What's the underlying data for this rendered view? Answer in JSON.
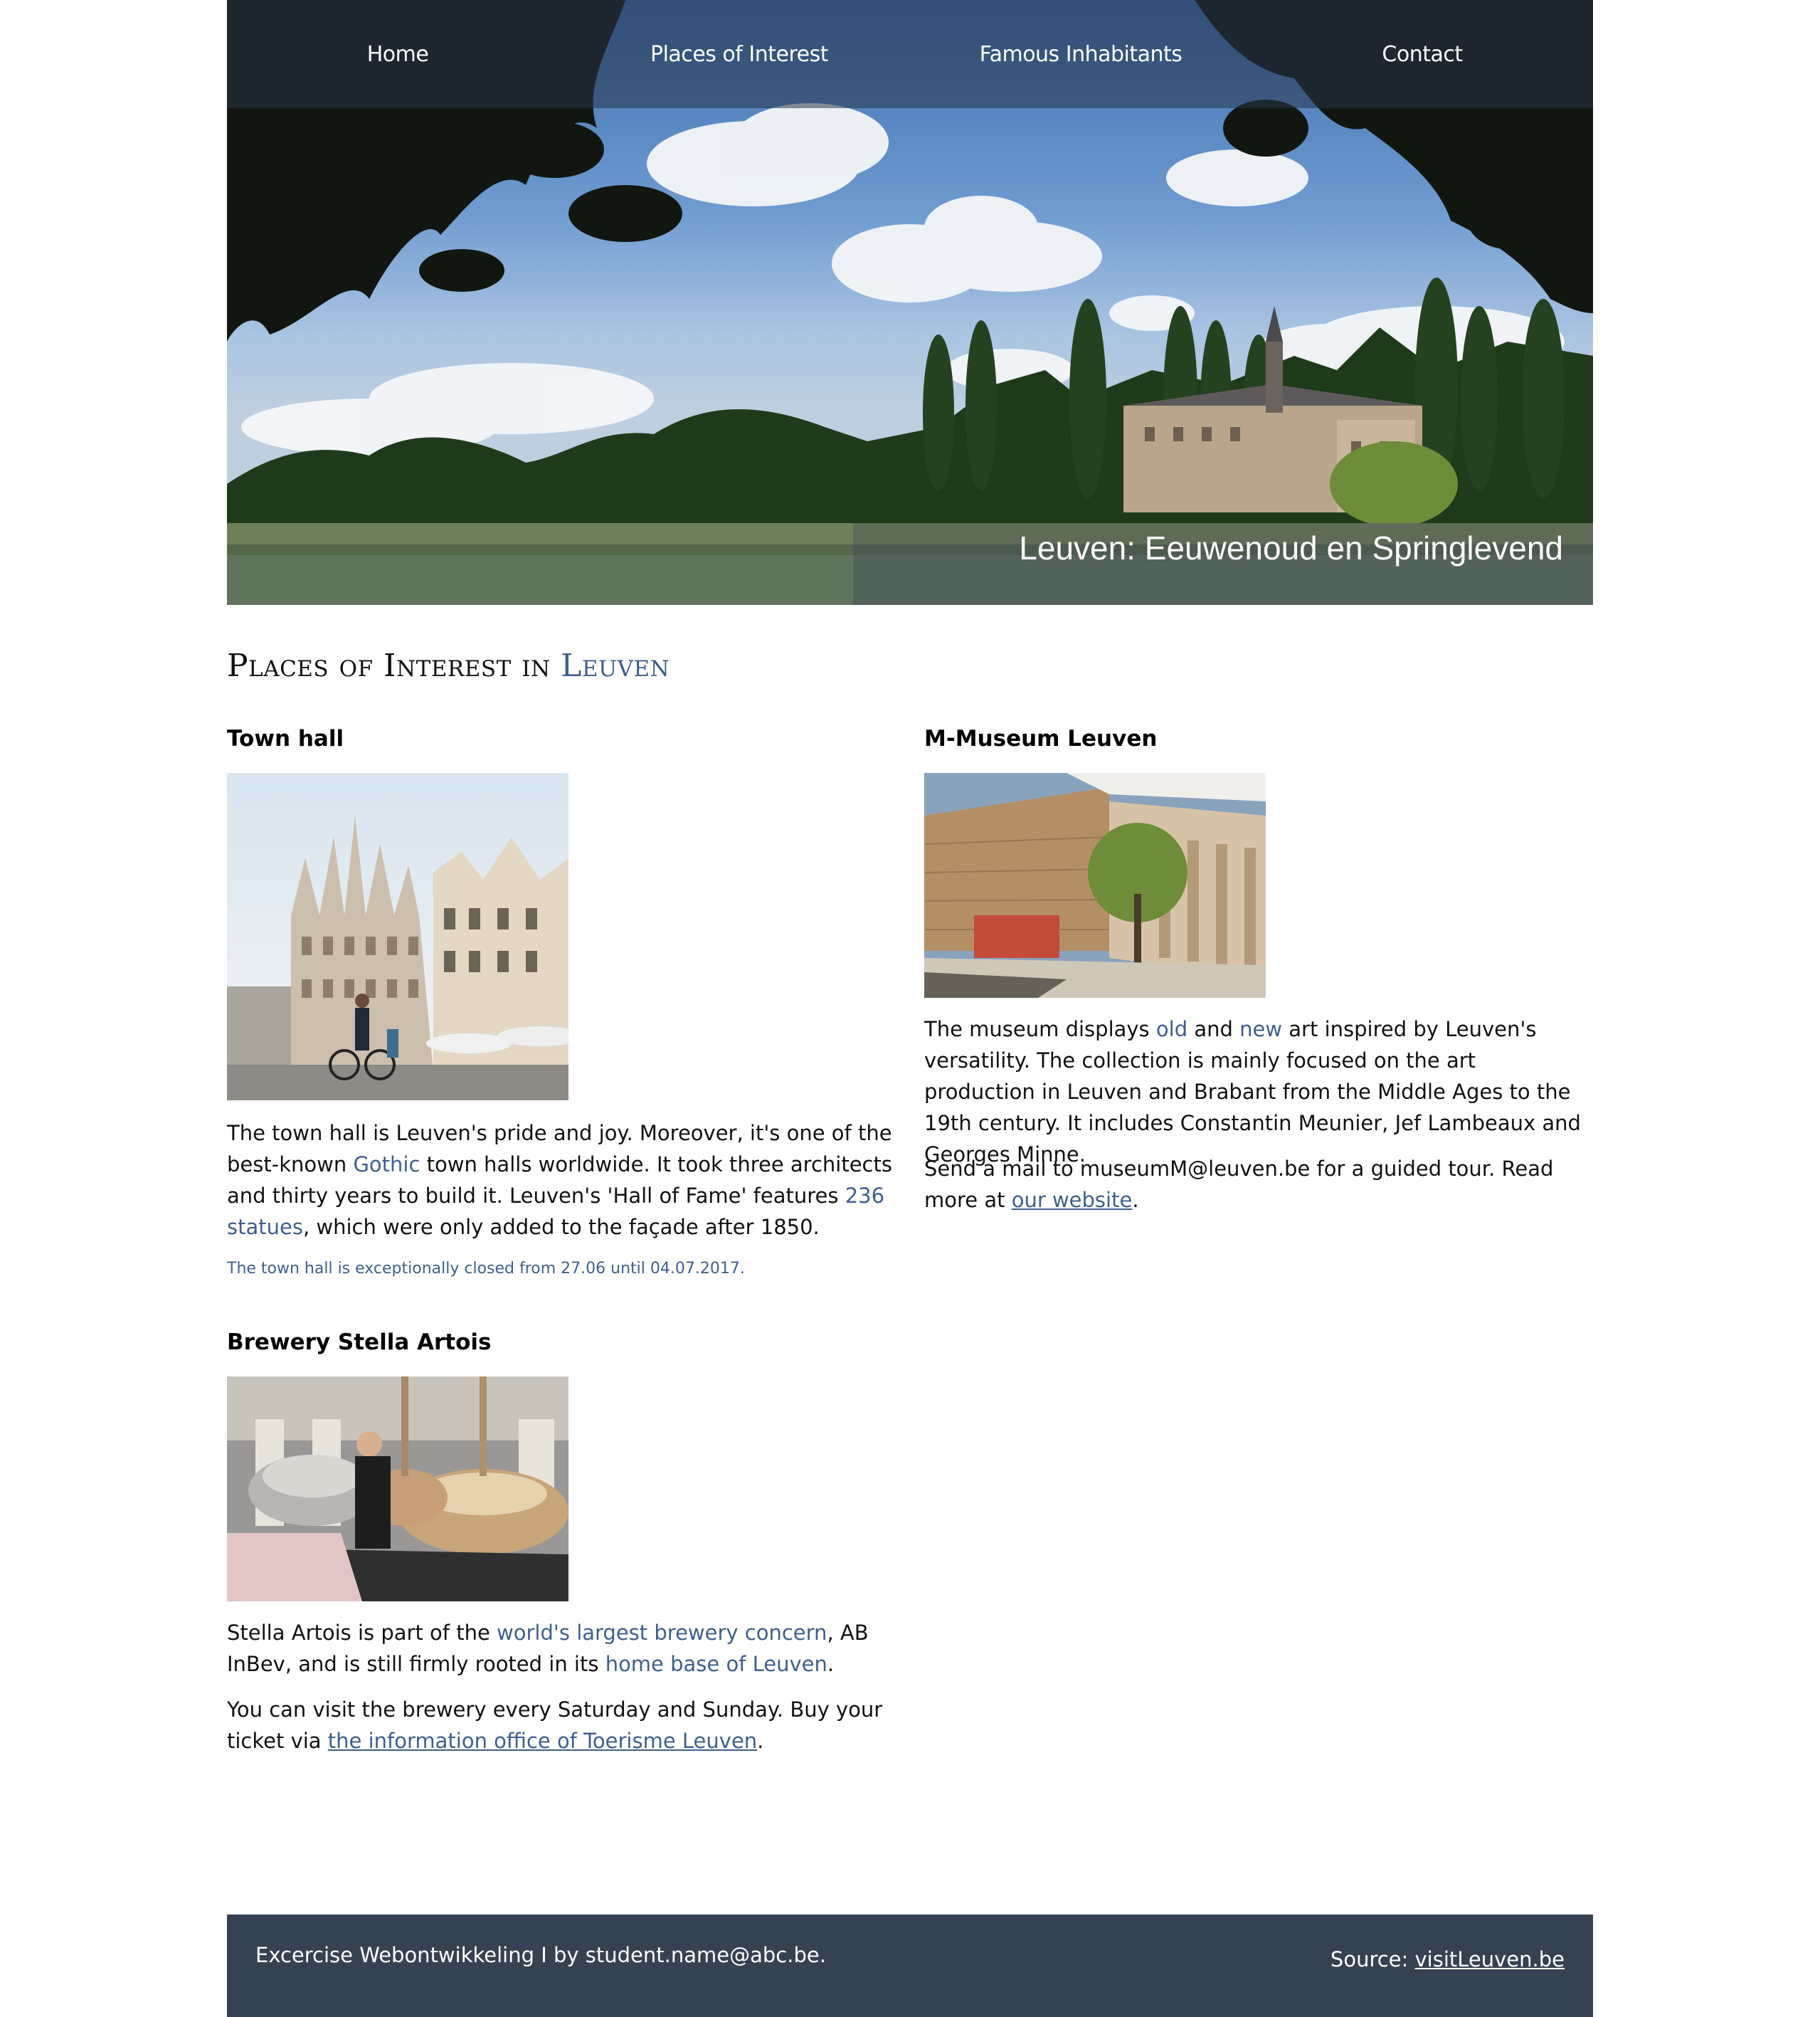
{
  "nav": {
    "items": [
      "Home",
      "Places of Interest",
      "Famous Inhabitants",
      "Contact"
    ]
  },
  "hero": {
    "caption": "Leuven: Eeuwenoud en Springlevend"
  },
  "page": {
    "title_main": "Places of Interest in ",
    "title_accent": "Leuven"
  },
  "town_hall": {
    "heading": "Town hall",
    "p1_a": "The town hall is Leuven's pride and joy. Moreover, it's one of the best-known ",
    "p1_link1": "Gothic",
    "p1_b": " town halls worldwide. It took three architects and thirty years to build it. Leuven's 'Hall of Fame' features ",
    "p1_link2": "236 statues",
    "p1_c": ", which were only added to the façade after 1850.",
    "note": "The town hall is exceptionally closed from 27.06 until 04.07.2017."
  },
  "brewery": {
    "heading": "Brewery Stella Artois",
    "p1_a": "Stella Artois is part of the ",
    "p1_link1": "world's largest brewery concern",
    "p1_b": ", AB InBev, and is still firmly rooted in its ",
    "p1_link2": "home base of Leuven",
    "p1_c": ".",
    "p2_a": "You can visit the brewery every Saturday and Sunday. Buy your ticket via ",
    "p2_link": "the information office of Toerisme Leuven",
    "p2_b": "."
  },
  "museum": {
    "heading": "M-Museum Leuven",
    "p1_a": "The museum displays ",
    "p1_link1": "old",
    "p1_b": " and ",
    "p1_link2": "new",
    "p1_c": " art inspired by Leuven's versatility. The collection is mainly focused on the art production in Leuven and Brabant from the Middle Ages to the 19th century. It includes Constantin Meunier, Jef Lambeaux and Georges Minne.",
    "p2_a": "Send a mail to museumM@leuven.be for a guided tour. Read more at ",
    "p2_link": "our website",
    "p2_b": "."
  },
  "footer": {
    "left": "Excercise Webontwikkeling I by student.name@abc.be.",
    "source_label": "Source: ",
    "source_link": "visitLeuven.be"
  },
  "colors": {
    "accent": "#3f5f8f",
    "footer_bg": "#364252"
  }
}
